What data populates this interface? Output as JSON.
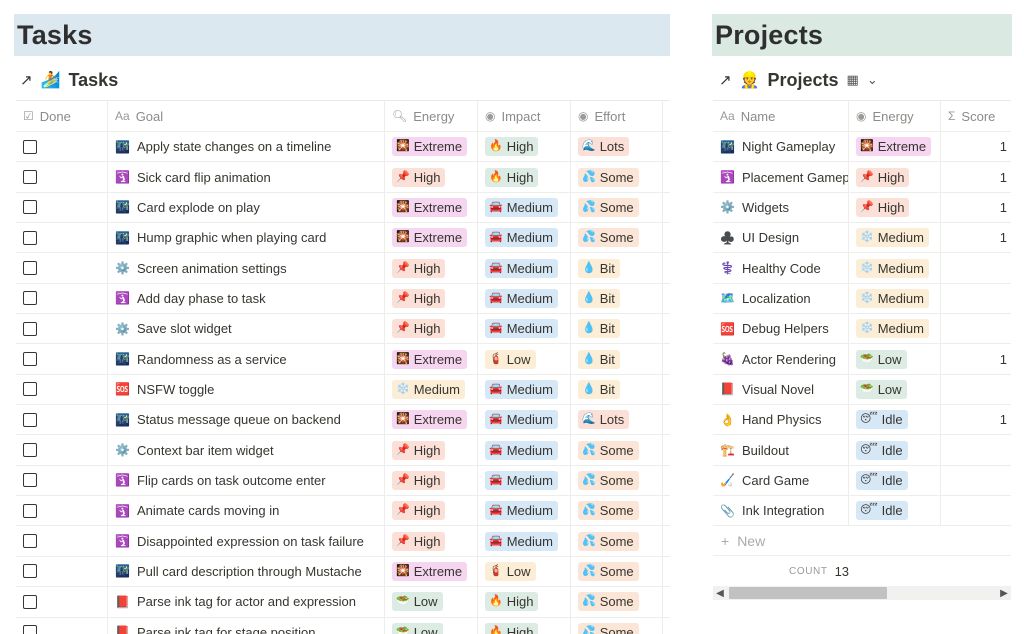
{
  "colors": {
    "extreme": "#f5d5ef",
    "high": "#fbe0d8",
    "medium_energy": "#fbedd6",
    "low_energy": "#dcebe3",
    "idle": "#d6e7f6",
    "impact_high": "#dcebe3",
    "impact_medium": "#d6e7f6",
    "impact_low": "#fbedd6",
    "lots": "#fbe0d8",
    "some": "#fbe5d6",
    "bit": "#fbedd6"
  },
  "tasks": {
    "banner": "Tasks",
    "view_title": "Tasks",
    "headers": {
      "done": "Done",
      "goal": "Goal",
      "energy": "Energy",
      "impact": "Impact",
      "effort": "Effort"
    },
    "rows": [
      {
        "icon": "🌃",
        "goal": "Apply state changes on a timeline",
        "energy": "Extreme",
        "impact": "High",
        "effort": "Lots"
      },
      {
        "icon": "🛐",
        "goal": "Sick card flip animation",
        "energy": "High",
        "impact": "High",
        "effort": "Some"
      },
      {
        "icon": "🌃",
        "goal": "Card explode on play",
        "energy": "Extreme",
        "impact": "Medium",
        "effort": "Some"
      },
      {
        "icon": "🌃",
        "goal": "Hump graphic when playing card",
        "energy": "Extreme",
        "impact": "Medium",
        "effort": "Some"
      },
      {
        "icon": "⚙️",
        "goal": "Screen animation settings",
        "energy": "High",
        "impact": "Medium",
        "effort": "Bit"
      },
      {
        "icon": "🛐",
        "goal": "Add day phase to task",
        "energy": "High",
        "impact": "Medium",
        "effort": "Bit"
      },
      {
        "icon": "⚙️",
        "goal": "Save slot widget",
        "energy": "High",
        "impact": "Medium",
        "effort": "Bit"
      },
      {
        "icon": "🌃",
        "goal": "Randomness as a service",
        "energy": "Extreme",
        "impact": "Low",
        "effort": "Bit"
      },
      {
        "icon": "🆘",
        "goal": "NSFW toggle",
        "energy": "Medium",
        "impact": "Medium",
        "effort": "Bit"
      },
      {
        "icon": "🌃",
        "goal": "Status message queue on backend",
        "energy": "Extreme",
        "impact": "Medium",
        "effort": "Lots"
      },
      {
        "icon": "⚙️",
        "goal": "Context bar item widget",
        "energy": "High",
        "impact": "Medium",
        "effort": "Some"
      },
      {
        "icon": "🛐",
        "goal": "Flip cards on task outcome enter",
        "energy": "High",
        "impact": "Medium",
        "effort": "Some"
      },
      {
        "icon": "🛐",
        "goal": "Animate cards moving in",
        "energy": "High",
        "impact": "Medium",
        "effort": "Some"
      },
      {
        "icon": "🛐",
        "goal": "Disappointed expression on task failure",
        "energy": "High",
        "impact": "Medium",
        "effort": "Some"
      },
      {
        "icon": "🌃",
        "goal": "Pull card description through Mustache",
        "energy": "Extreme",
        "impact": "Low",
        "effort": "Some"
      },
      {
        "icon": "📕",
        "goal": "Parse ink tag for actor and expression",
        "energy": "Low",
        "impact": "High",
        "effort": "Some"
      },
      {
        "icon": "📕",
        "goal": "Parse ink tag for stage position",
        "energy": "Low",
        "impact": "High",
        "effort": "Some"
      }
    ]
  },
  "projects": {
    "banner": "Projects",
    "view_title": "Projects",
    "headers": {
      "name": "Name",
      "energy": "Energy",
      "score": "Score"
    },
    "rows": [
      {
        "icon": "🌃",
        "name": "Night Gameplay",
        "energy": "Extreme",
        "score": "1"
      },
      {
        "icon": "🛐",
        "name": "Placement Gameplay",
        "energy": "High",
        "score": "1"
      },
      {
        "icon": "⚙️",
        "name": "Widgets",
        "energy": "High",
        "score": "1"
      },
      {
        "icon": "♣️",
        "name": "UI Design",
        "energy": "Medium",
        "score": "1"
      },
      {
        "icon": "⚕️",
        "name": "Healthy Code",
        "energy": "Medium",
        "score": ""
      },
      {
        "icon": "🗺️",
        "name": "Localization",
        "energy": "Medium",
        "score": ""
      },
      {
        "icon": "🆘",
        "name": "Debug Helpers",
        "energy": "Medium",
        "score": ""
      },
      {
        "icon": "🍇",
        "name": "Actor Rendering",
        "energy": "Low",
        "score": "1"
      },
      {
        "icon": "📕",
        "name": "Visual Novel",
        "energy": "Low",
        "score": ""
      },
      {
        "icon": "👌",
        "name": "Hand Physics",
        "energy": "Idle",
        "score": "1"
      },
      {
        "icon": "🏗️",
        "name": "Buildout",
        "energy": "Idle",
        "score": ""
      },
      {
        "icon": "🏑",
        "name": "Card Game",
        "energy": "Idle",
        "score": ""
      },
      {
        "icon": "📎",
        "name": "Ink Integration",
        "energy": "Idle",
        "score": ""
      }
    ],
    "new_label": "New",
    "count_label": "COUNT",
    "count_value": "13"
  }
}
